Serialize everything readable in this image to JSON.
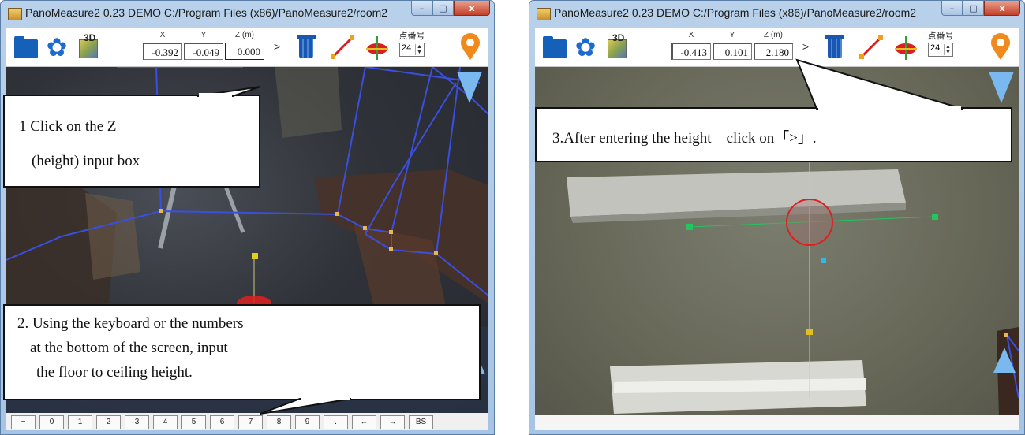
{
  "windows": [
    {
      "title": "PanoMeasure2 0.23 DEMO  C:/Program Files (x86)/PanoMeasure2/room2",
      "coords": {
        "x_label": "X",
        "y_label": "Y",
        "z_label": "Z (m)",
        "x": "-0.392",
        "y": "-0.049",
        "z": "0.000"
      },
      "next_label": ">",
      "point_label": "点番号",
      "point_value": "24",
      "keypad": [
        "−",
        "0",
        "1",
        "2",
        "3",
        "4",
        "5",
        "6",
        "7",
        "8",
        "9",
        ".",
        "←",
        "→",
        "BS"
      ]
    },
    {
      "title": "PanoMeasure2 0.23 DEMO  C:/Program Files (x86)/PanoMeasure2/room2",
      "coords": {
        "x_label": "X",
        "y_label": "Y",
        "z_label": "Z (m)",
        "x": "-0.413",
        "y": "0.101",
        "z": "2.180"
      },
      "next_label": ">",
      "point_label": "点番号",
      "point_value": "24"
    }
  ],
  "title_buttons": {
    "minimize": "–",
    "maximize": "□",
    "close": "x"
  },
  "toolbar": {
    "cube_label": "3D",
    "gear_glyph": "✿"
  },
  "callouts": {
    "step1_line1": "1 Click on the Z",
    "step1_line2": "(height) input box",
    "step2_line1": "2. Using the keyboard or the numbers",
    "step2_line2": "at the bottom of the screen, input",
    "step2_line3": "the floor to ceiling height.",
    "step3": "3.After entering the height　click on「>」."
  },
  "colors": {
    "wireframe": "#3a4fe0",
    "marker": "#e8b84a",
    "crosshair": "#e0e040",
    "green": "#22c55e",
    "cyan": "#30b8e8",
    "red": "#e02020",
    "arrow": "#7ab8f0"
  }
}
